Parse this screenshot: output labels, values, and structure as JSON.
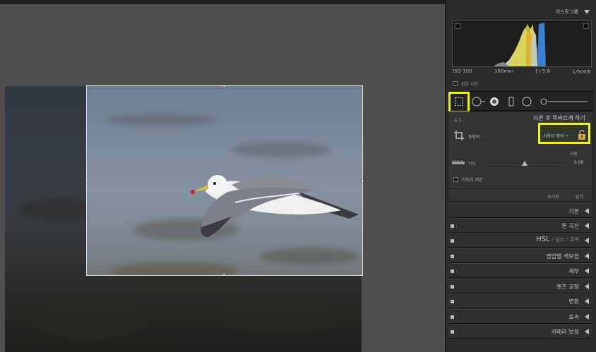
{
  "panel": {
    "histogram_title": "히스토그램",
    "histogram_info": {
      "iso": "ISO 100",
      "focal": "180mm",
      "aperture": "ƒ / 5.6",
      "shutter": "1/500초"
    },
    "original_photo_label": "원본 사진",
    "crop": {
      "title": "자른 후 똑바르게 하기",
      "tool_label": "도구 :",
      "aspect_label": "종횡비 :",
      "aspect_value": "사용자 정의 ÷",
      "auto_label": "자동",
      "angle_label": "각도",
      "angle_value": "0.00",
      "constrain_label": "이미지 제한",
      "reset_label": "초기화",
      "close_label": "닫기"
    },
    "sections": [
      {
        "label": "기본"
      },
      {
        "label": "톤 곡선"
      },
      {
        "label": "HSL",
        "extra": [
          "컬러",
          "흑백"
        ]
      },
      {
        "label": "명암별 색보정"
      },
      {
        "label": "세부"
      },
      {
        "label": "렌즈 교정"
      },
      {
        "label": "변환"
      },
      {
        "label": "효과"
      },
      {
        "label": "카메라 보정"
      }
    ]
  },
  "colors": {
    "highlight": "#f2f20a",
    "panel_bg": "#2b2b2b",
    "image_bg": "#4f4f4f"
  },
  "icons": [
    "crop-overlay-icon",
    "spot-removal-icon",
    "red-eye-icon",
    "graduated-filter-icon",
    "radial-filter-icon",
    "adjustment-brush-icon",
    "lock-icon",
    "straighten-ruler-icon",
    "crop-angle-icon"
  ]
}
